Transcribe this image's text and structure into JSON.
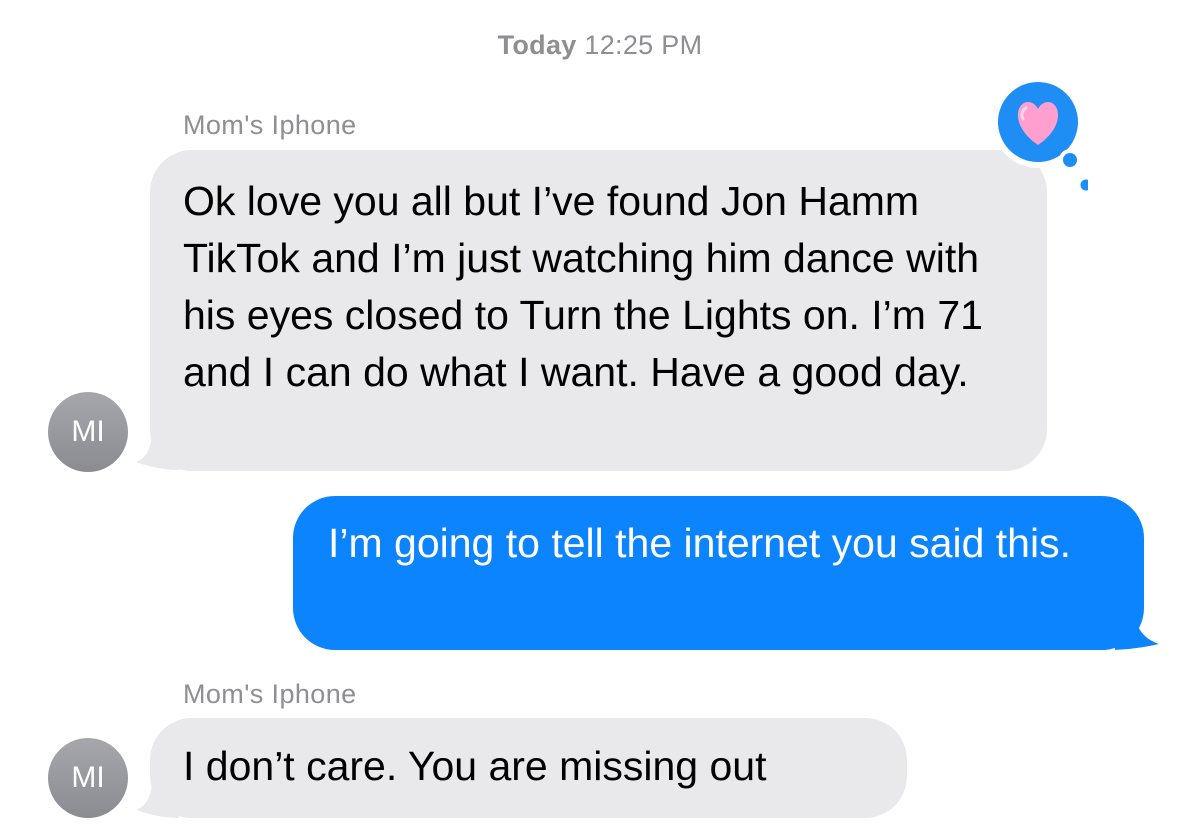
{
  "timestamp": {
    "day": "Today",
    "time": "12:25 PM"
  },
  "messages": [
    {
      "sender": "Mom's Iphone",
      "avatar": "MI",
      "text": "Ok love you all but I’ve found Jon Hamm TikTok and I’m just watching him dance with his eyes closed to Turn the Lights on. I’m 71 and I can do what I want. Have a good day.",
      "reaction": "heart-icon"
    },
    {
      "text": "I’m going to tell the internet you said this."
    },
    {
      "sender": "Mom's Iphone",
      "avatar": "MI",
      "text": "I don’t care. You are missing out"
    }
  ],
  "colors": {
    "incoming_bubble": "#e9e9eb",
    "outgoing_bubble": "#0b84fe",
    "reaction_bubble": "#1e8ef5",
    "heart": "#ff9fd0",
    "avatar": "#9a9ca2",
    "meta_text": "#8e8e93"
  }
}
